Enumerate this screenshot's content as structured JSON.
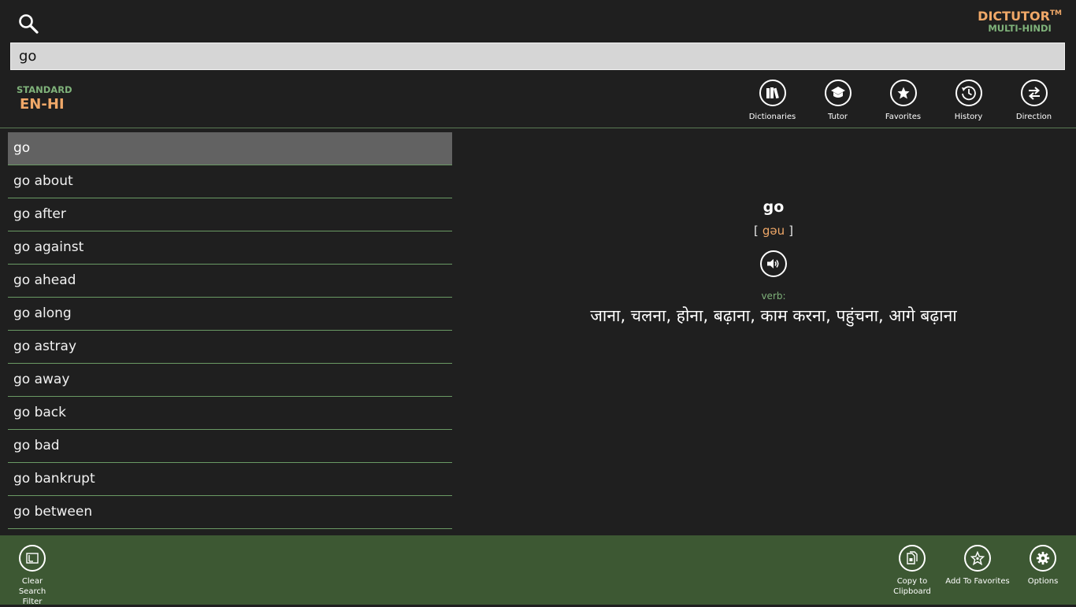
{
  "header": {
    "search_icon": "search-icon",
    "brand_name": "DICTUTOR",
    "brand_tm": "TM",
    "brand_sub": "MULTI-HINDI"
  },
  "search": {
    "value": "go",
    "placeholder": ""
  },
  "dictionary": {
    "type": "STANDARD",
    "pair": "EN-HI"
  },
  "topnav": [
    {
      "label": "Dictionaries",
      "icon": "books-icon"
    },
    {
      "label": "Tutor",
      "icon": "graduation-cap-icon"
    },
    {
      "label": "Favorites",
      "icon": "star-icon"
    },
    {
      "label": "History",
      "icon": "clock-history-icon"
    },
    {
      "label": "Direction",
      "icon": "swap-arrows-icon"
    }
  ],
  "wordlist": [
    "go",
    "go about",
    "go after",
    "go against",
    "go ahead",
    "go along",
    "go astray",
    "go away",
    "go back",
    "go bad",
    "go bankrupt",
    "go between"
  ],
  "selected_index": 0,
  "entry": {
    "headword": "go",
    "bracket_open": "[",
    "pronunciation": "gəu",
    "bracket_close": "]",
    "speaker_icon": "speaker-icon",
    "pos": "verb:",
    "translation": "जाना, चलना, होना, बढ़ाना, काम करना, पहुंचना, आगे बढ़ाना"
  },
  "appbar": {
    "clear_filter": {
      "label": "Clear Search Filter",
      "icon": "clear-filter-icon"
    },
    "copy": {
      "label": "Copy to Clipboard",
      "icon": "copy-icon"
    },
    "add_favorites": {
      "label": "Add To Favorites",
      "icon": "star-add-icon"
    },
    "options": {
      "label": "Options",
      "icon": "gear-icon"
    }
  },
  "colors": {
    "background": "#1f1f1f",
    "accent_orange": "#f0a868",
    "accent_green": "#7fb27a",
    "appbar": "#3d5833",
    "selected_row": "#626262"
  }
}
